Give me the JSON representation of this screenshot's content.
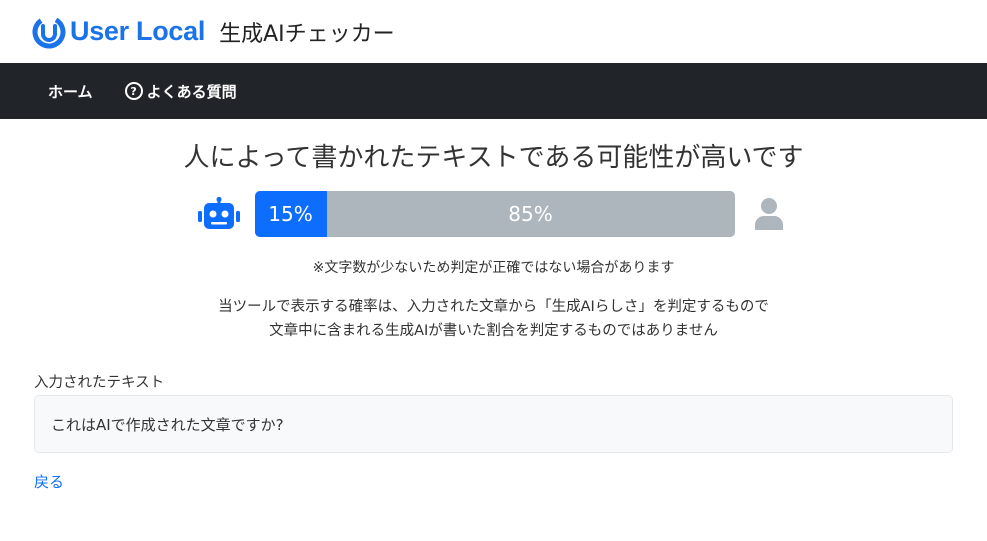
{
  "header": {
    "brand": "User Local",
    "product_title": "生成AIチェッカー",
    "brand_color": "#1a73e8"
  },
  "nav": {
    "items": [
      {
        "label": "ホーム",
        "icon": null
      },
      {
        "label": "よくある質問",
        "icon": "question-circle-icon"
      }
    ],
    "background": "#212529"
  },
  "result": {
    "heading": "人によって書かれたテキストである可能性が高いです",
    "ai_percent": 15,
    "ai_label": "15%",
    "human_percent": 85,
    "human_label": "85%",
    "ai_color": "#0d6efd",
    "human_color": "#adb5bd",
    "note": "※文字数が少ないため判定が正確ではない場合があります",
    "description_line1": "当ツールで表示する確率は、入力された文章から「生成AIらしさ」を判定するもので",
    "description_line2": "文章中に含まれる生成AIが書いた割合を判定するものではありません"
  },
  "input": {
    "label": "入力されたテキスト",
    "value": "これはAIで作成された文章ですか?"
  },
  "back_link": "戻る"
}
